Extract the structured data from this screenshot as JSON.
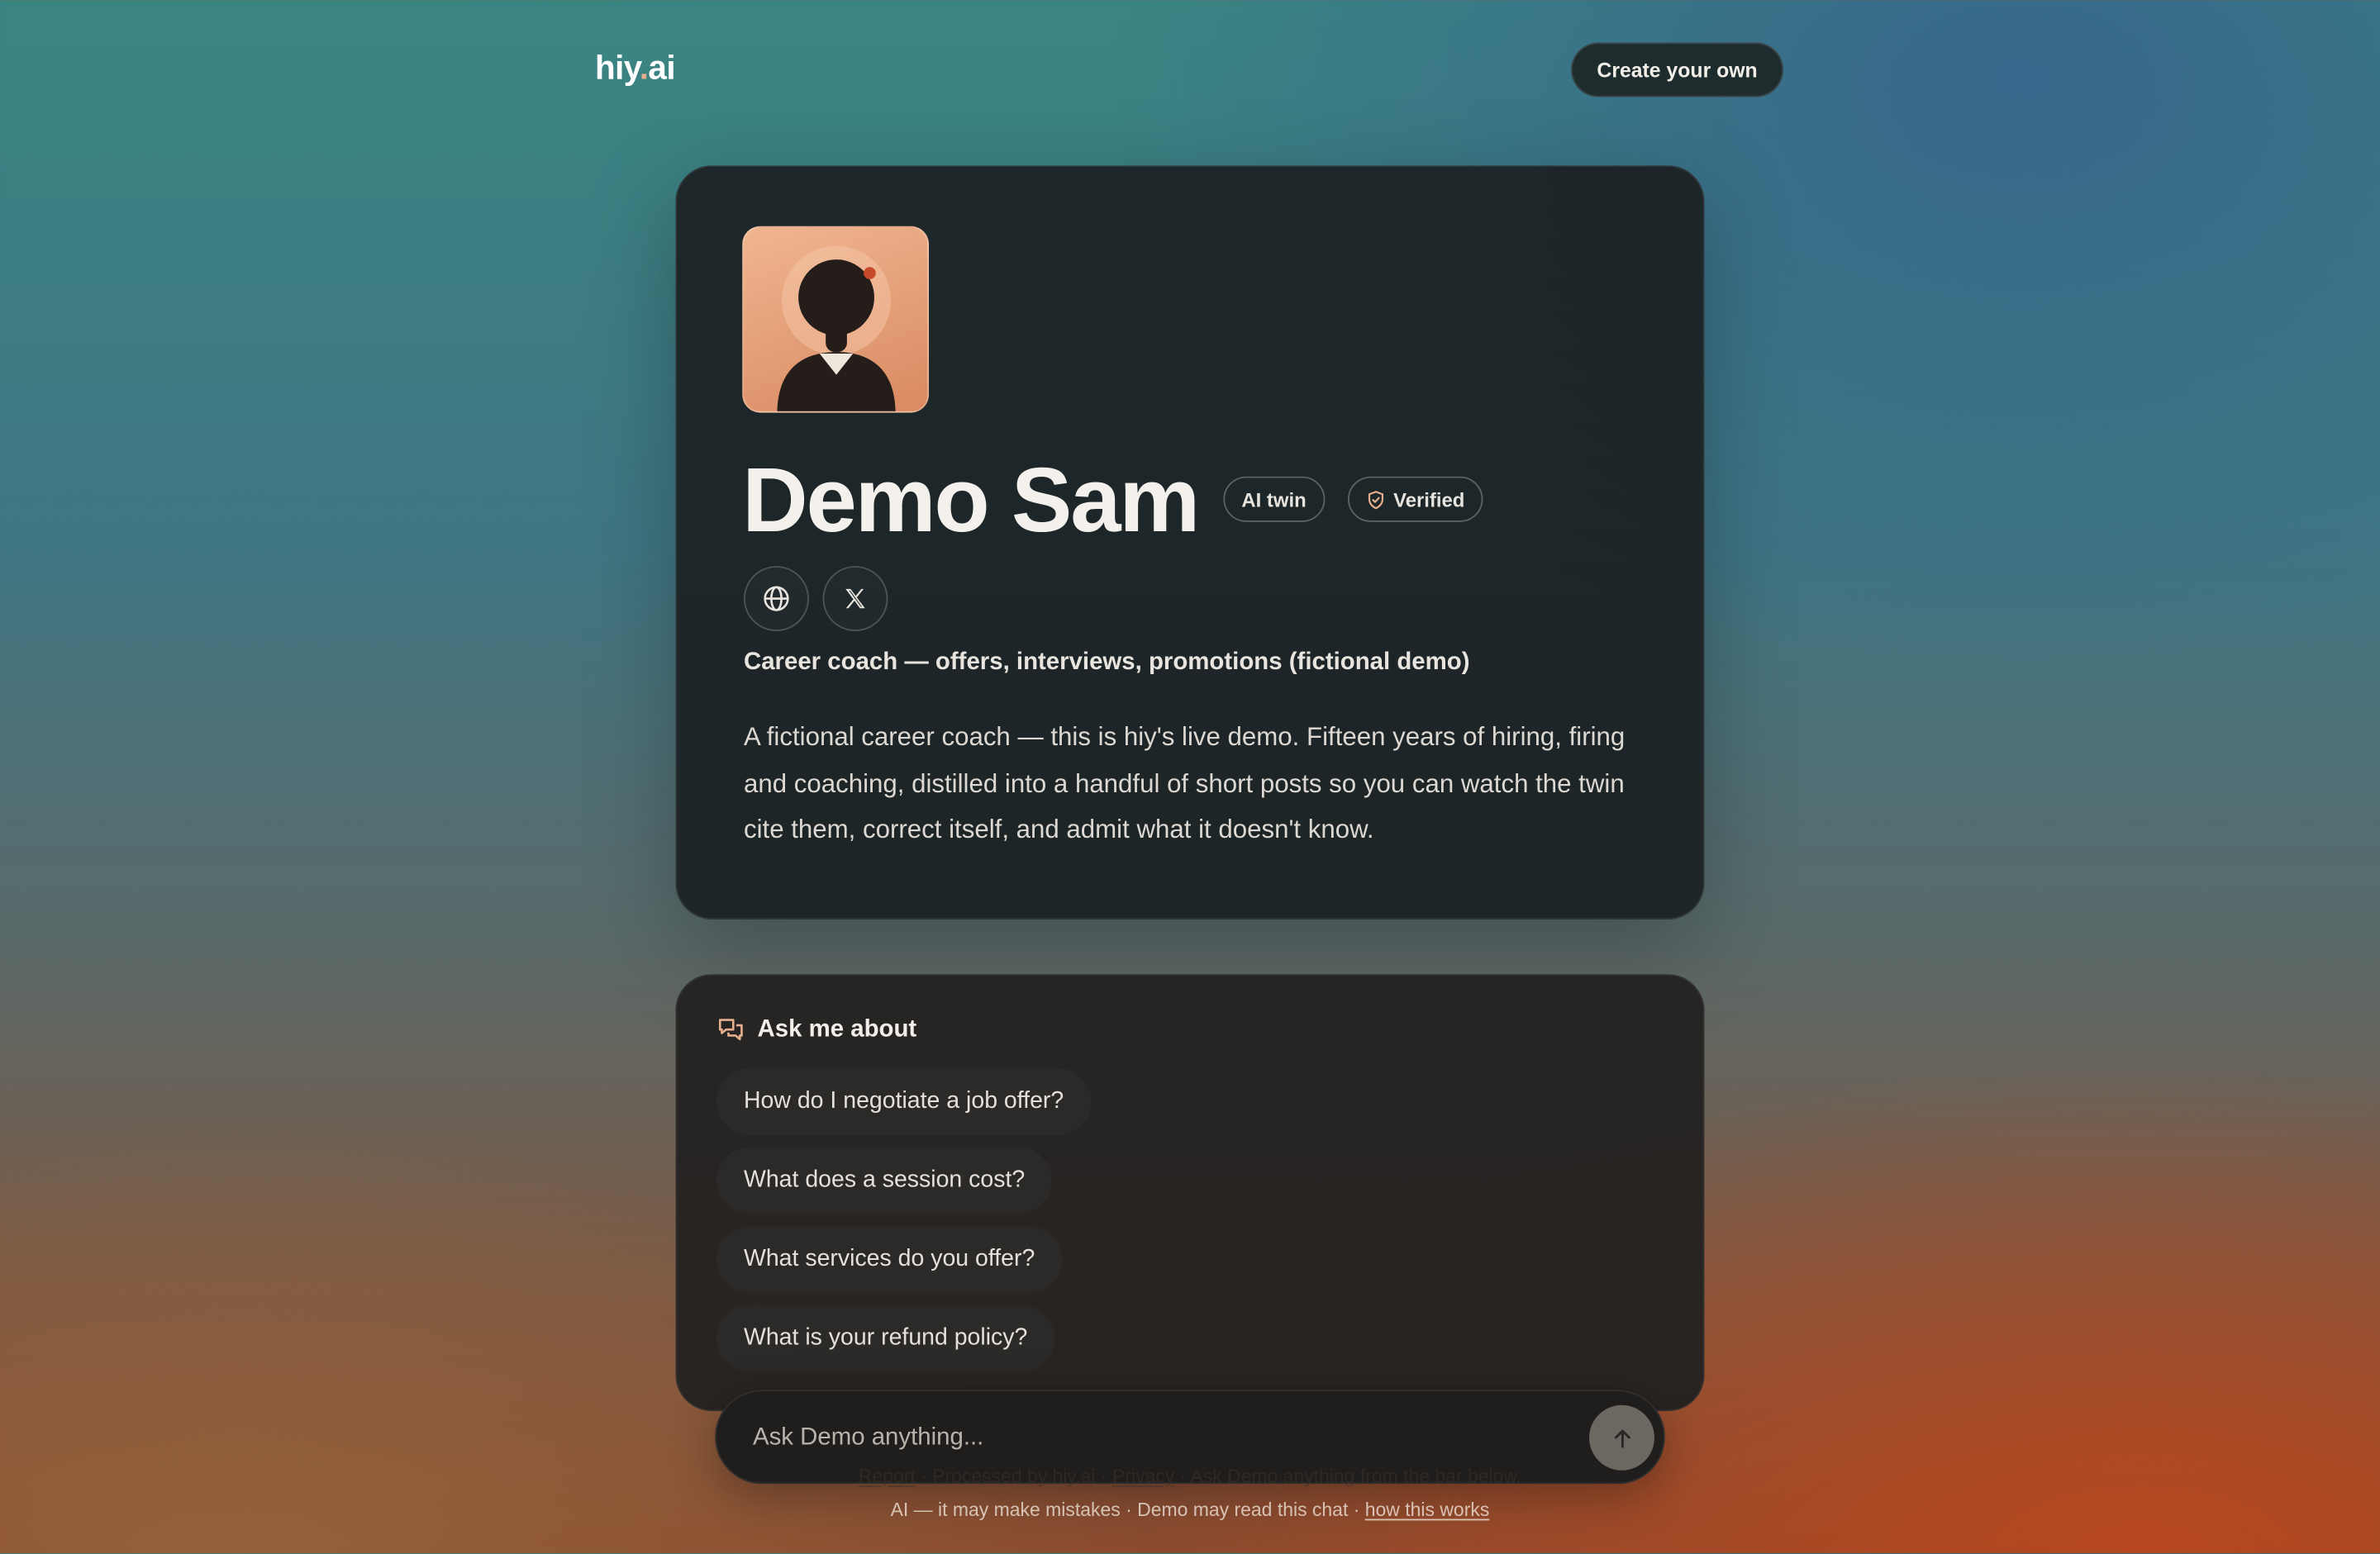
{
  "header": {
    "logo_main": "hiy",
    "logo_dot": ".",
    "logo_tld": "ai",
    "cta_label": "Create your own"
  },
  "profile": {
    "name": "Demo Sam",
    "badge_ai": "AI twin",
    "badge_verified": "Verified",
    "tagline": "Career coach — offers, interviews, promotions (fictional demo)",
    "description": "A fictional career coach — this is hiy's live demo. Fifteen years of hiring, firing and coaching, distilled into a handful of short posts so you can watch the twin cite them, correct itself, and admit what it doesn't know.",
    "links": [
      "globe-icon",
      "x-logo-icon"
    ]
  },
  "ask": {
    "title": "Ask me about",
    "suggestions": [
      "How do I negotiate a job offer?",
      "What does a session cost?",
      "What services do you offer?",
      "What is your refund policy?"
    ],
    "input_placeholder": "Ask Demo anything...",
    "input_value": ""
  },
  "footer": {
    "line1_report": "Report",
    "line1_sep1": " · ",
    "line1_processed": "Processed by hiy.ai",
    "line1_sep2": " · ",
    "line1_privacy": "Privacy",
    "line1_sep3": " · ",
    "line1_hint": "Ask Demo anything from the bar below.",
    "line2_text": "AI — it may make mistakes · Demo may read this chat · ",
    "line2_link": "how this works"
  },
  "colors": {
    "accent": "#e6b08e",
    "card_bg": "#1c2224",
    "text_primary": "#f4f1ec"
  }
}
